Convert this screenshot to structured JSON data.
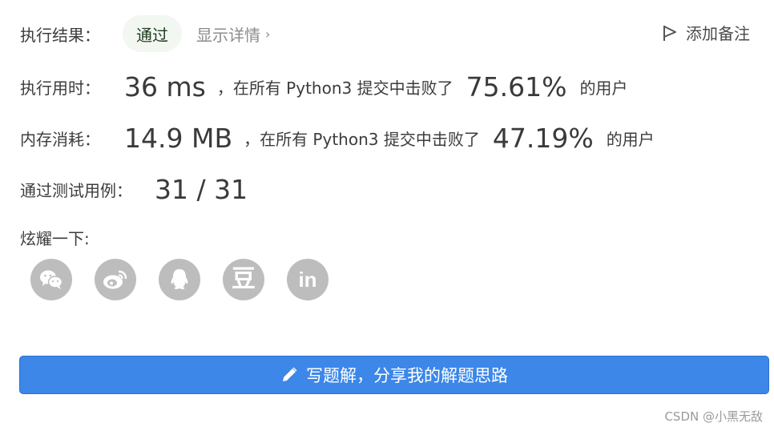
{
  "result": {
    "label": "执行结果：",
    "status": "通过",
    "detail_link": "显示详情",
    "detail_chevron": "›",
    "add_note": "添加备注"
  },
  "runtime": {
    "label": "执行用时：",
    "value": "36 ms",
    "text": "，在所有 Python3 提交中击败了",
    "percent": "75.61%",
    "suffix": "的用户"
  },
  "memory": {
    "label": "内存消耗：",
    "value": "14.9 MB",
    "text": "，在所有 Python3 提交中击败了",
    "percent": "47.19%",
    "suffix": "的用户"
  },
  "tests": {
    "label": "通过测试用例：",
    "value": "31 / 31"
  },
  "share": {
    "label": "炫耀一下:",
    "icons": [
      "wechat-icon",
      "weibo-icon",
      "qq-icon",
      "douban-icon",
      "linkedin-icon"
    ],
    "douban_glyph": "豆",
    "linkedin_glyph": "in"
  },
  "write_solution": {
    "label": "写题解，分享我的解题思路"
  },
  "watermark": "CSDN @小黑无敌",
  "colors": {
    "accent": "#3c87e8",
    "pass_bg": "#f2f7f2",
    "icon_bg": "#bdbdbd"
  }
}
